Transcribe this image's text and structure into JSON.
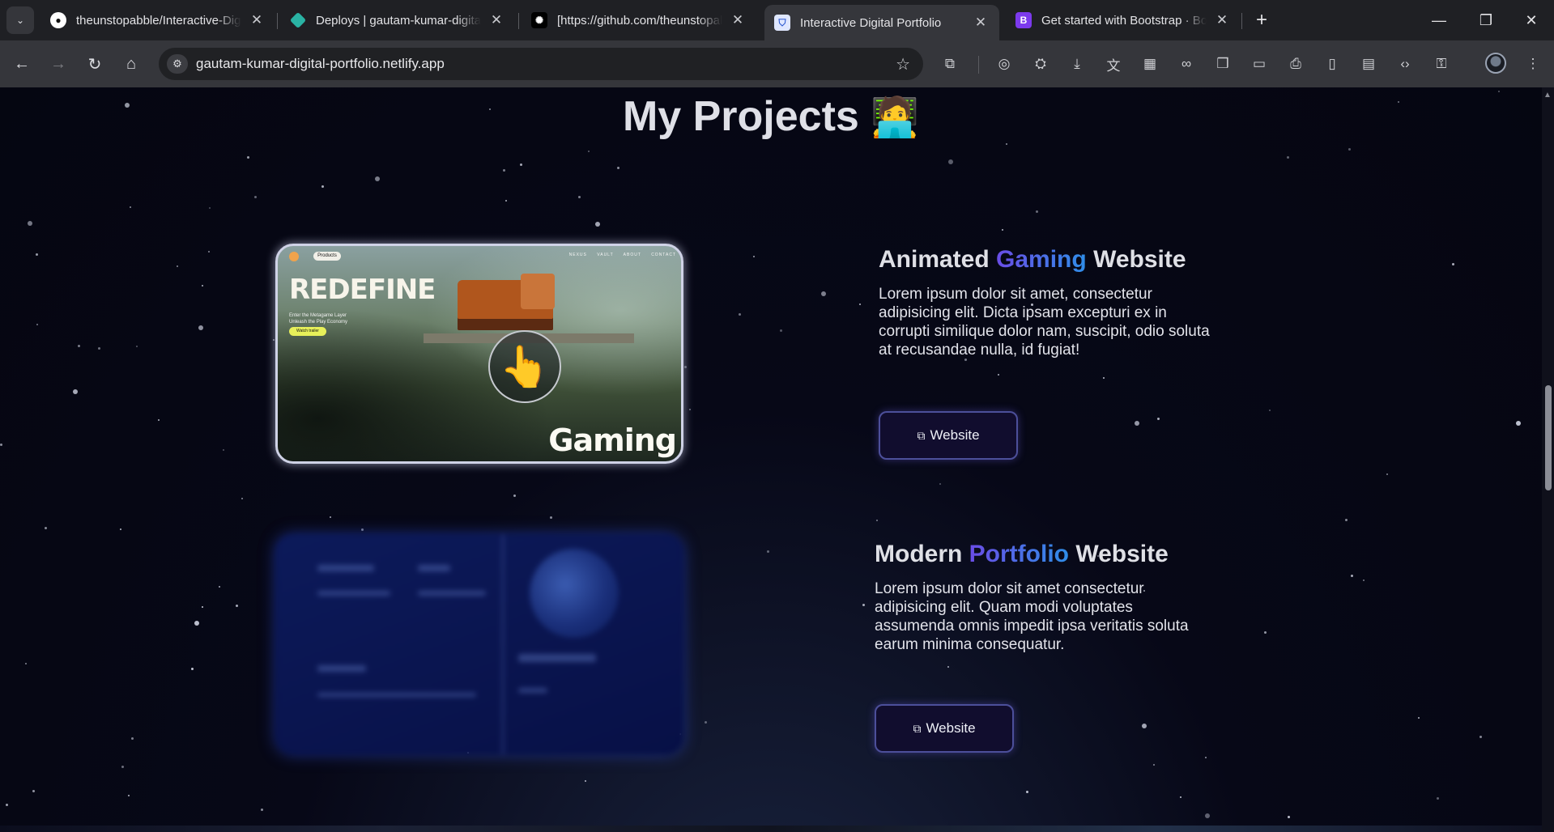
{
  "tabs": [
    {
      "label": "theunstopabble/Interactive-Digital-Portfolio",
      "favicon": "github-icon",
      "color": "#ffffff",
      "active": false
    },
    {
      "label": "Deploys | gautam-kumar-digital-portfolio",
      "favicon": "netlify-icon",
      "color": "#2ab3a4",
      "active": false
    },
    {
      "label": "[https://github.com/theunstopabble",
      "favicon": "app-icon",
      "color": "#ffffff",
      "active": false
    },
    {
      "label": "Interactive Digital Portfolio",
      "favicon": "shield-icon",
      "color": "#5b8def",
      "active": true
    },
    {
      "label": "Get started with Bootstrap · Bootstrap",
      "favicon": "bootstrap-icon",
      "color": "#7c3aed",
      "active": false
    }
  ],
  "omnibox": {
    "url": "gautam-kumar-digital-portfolio.netlify.app"
  },
  "page": {
    "section_title": "My Projects",
    "section_emoji": "🧑‍💻",
    "projects": [
      {
        "title_pre": "Animated",
        "title_accent": "Gaming",
        "title_post": "Website",
        "description": "Lorem ipsum dolor sit amet, consectetur adipisicing elit. Dicta ipsam excepturi ex in corrupti similique dolor nam, suscipit, odio soluta at recusandae nulla, id fugiat!",
        "button_label": "Website",
        "preview": {
          "headline": "REDEFINE",
          "corner_word": "Gaming",
          "pill": "Products",
          "nav_links": "NEXUS VAULT ABOUT CONTACT",
          "subtext": "Enter the Metagame Layer Unleash the Play Economy",
          "cta": "Watch trailer"
        }
      },
      {
        "title_pre": "Modern",
        "title_accent": "Portfolio",
        "title_post": "Website",
        "description": "Lorem ipsum dolor sit amet consectetur adipisicing elit. Quam modi voluptates assumenda omnis impedit ipsa veritatis soluta earum minima consequatur.",
        "button_label": "Website"
      }
    ]
  },
  "colors": {
    "accent_start": "#6a4de6",
    "accent_end": "#2f8ee8",
    "background": "#05060f",
    "button_bg": "#110d2e"
  }
}
